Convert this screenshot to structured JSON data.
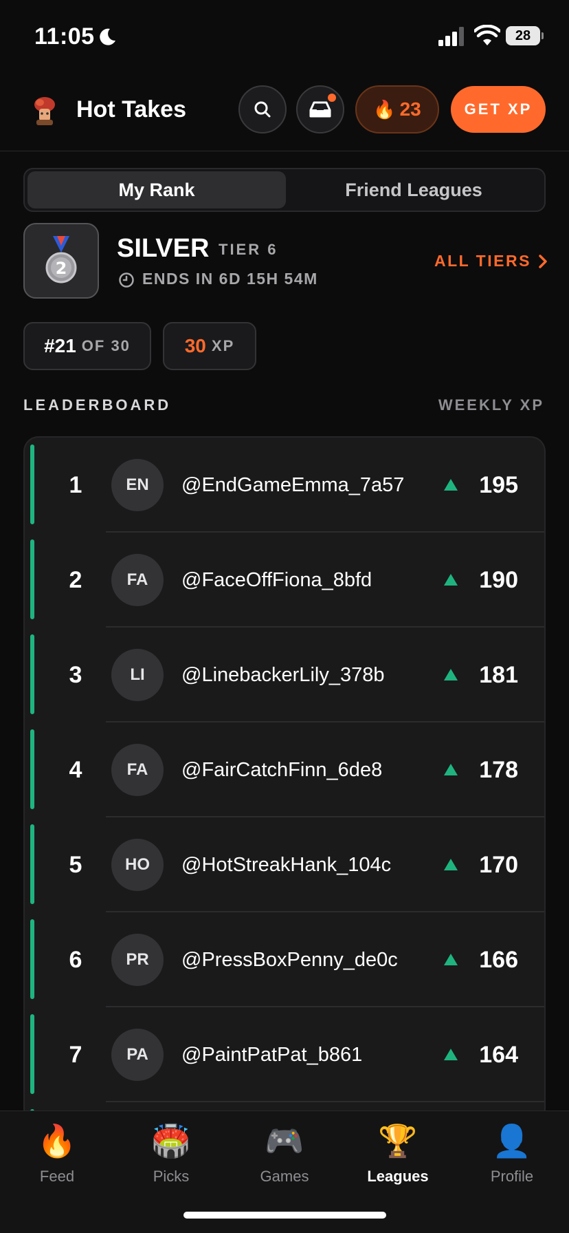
{
  "status_bar": {
    "time": "11:05",
    "battery": "28"
  },
  "header": {
    "app_title": "Hot Takes",
    "streak_count": "23",
    "get_xp_label": "GET XP"
  },
  "tabs": {
    "active": "My Rank",
    "inactive": "Friend Leagues"
  },
  "tier": {
    "badge_number": "2",
    "name": "SILVER",
    "level": "TIER 6",
    "ends": "ENDS IN 6D 15H 54M",
    "all_tiers_label": "ALL TIERS"
  },
  "stats": {
    "rank": "#21",
    "of_total": "OF 30",
    "xp_value": "30",
    "xp_unit": "XP"
  },
  "leaderboard": {
    "title": "LEADERBOARD",
    "subtitle": "WEEKLY XP",
    "accent_color": "#1fb47f",
    "rows": [
      {
        "rank": "1",
        "initials": "EN",
        "user": "@EndGameEmma_7a57",
        "xp": "195",
        "trend": "up"
      },
      {
        "rank": "2",
        "initials": "FA",
        "user": "@FaceOffFiona_8bfd",
        "xp": "190",
        "trend": "up"
      },
      {
        "rank": "3",
        "initials": "LI",
        "user": "@LinebackerLily_378b",
        "xp": "181",
        "trend": "up"
      },
      {
        "rank": "4",
        "initials": "FA",
        "user": "@FairCatchFinn_6de8",
        "xp": "178",
        "trend": "up"
      },
      {
        "rank": "5",
        "initials": "HO",
        "user": "@HotStreakHank_104c",
        "xp": "170",
        "trend": "up"
      },
      {
        "rank": "6",
        "initials": "PR",
        "user": "@PressBoxPenny_de0c",
        "xp": "166",
        "trend": "up"
      },
      {
        "rank": "7",
        "initials": "PA",
        "user": "@PaintPatPat_b861",
        "xp": "164",
        "trend": "up"
      }
    ]
  },
  "nav": {
    "items": [
      {
        "label": "Feed",
        "icon": "🔥"
      },
      {
        "label": "Picks",
        "icon": "🏟️"
      },
      {
        "label": "Games",
        "icon": "🎮"
      },
      {
        "label": "Leagues",
        "icon": "🏆"
      },
      {
        "label": "Profile",
        "icon": "👤"
      }
    ],
    "active": "Leagues"
  },
  "colors": {
    "accent": "#ff6a2c",
    "positive": "#1fb47f",
    "background": "#0c0c0d"
  }
}
